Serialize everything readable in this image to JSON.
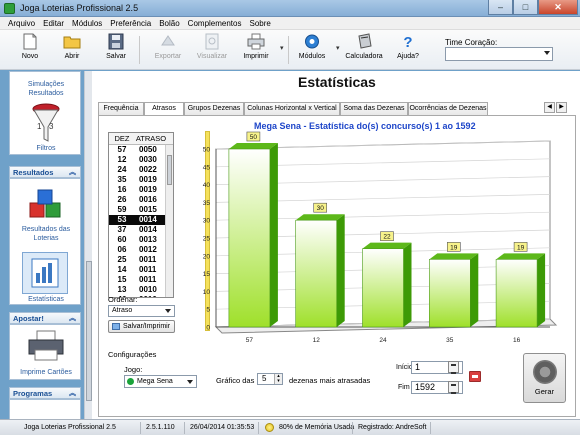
{
  "window": {
    "title": "Joga Loterias Profissional 2.5",
    "controls": [
      "–",
      "□",
      "✕"
    ]
  },
  "menu": [
    "Arquivo",
    "Editar",
    "Módulos",
    "Preferência",
    "Bolão",
    "Complementos",
    "Sobre"
  ],
  "toolbar": {
    "novo": "Novo",
    "abrir": "Abrir",
    "salvar": "Salvar",
    "exportar": "Exportar",
    "visualizar": "Visualizar",
    "imprimir": "Imprimir",
    "modulos": "Módulos",
    "calculadora": "Calculadora",
    "ajuda": "Ajuda?",
    "time_label": "Time Coração:",
    "time_value": ""
  },
  "sidebar": {
    "item_simulacoes": "Simulações Resultados",
    "item_filtros": "Filtros",
    "section_resultados": "Resultados",
    "item_resultados_loterias": "Resultados das Loterias",
    "item_estatisticas": "Estatísticas",
    "section_apostar": "Apostar!",
    "item_imprime_cartoes": "Imprime Cartões",
    "section_programas": "Programas",
    "chevron": "︽"
  },
  "main": {
    "title": "Estatísticas",
    "tabs": [
      "Frequência",
      "Atrasos",
      "Grupos Dezenas",
      "Colunas Horizontal x Vertical",
      "Soma das Dezenas",
      "Ocorrências de Dezenas"
    ],
    "active_tab": "Atrasos",
    "tab_prev": "◀",
    "tab_next": "▶"
  },
  "number_list": {
    "col_dez": "DEZ",
    "col_atraso": "ATRASO",
    "rows": [
      {
        "dez": "57",
        "atraso": "0050"
      },
      {
        "dez": "12",
        "atraso": "0030"
      },
      {
        "dez": "24",
        "atraso": "0022"
      },
      {
        "dez": "35",
        "atraso": "0019"
      },
      {
        "dez": "16",
        "atraso": "0019"
      },
      {
        "dez": "26",
        "atraso": "0016"
      },
      {
        "dez": "59",
        "atraso": "0015"
      },
      {
        "dez": "53",
        "atraso": "0014"
      },
      {
        "dez": "37",
        "atraso": "0014"
      },
      {
        "dez": "60",
        "atraso": "0013"
      },
      {
        "dez": "06",
        "atraso": "0012"
      },
      {
        "dez": "25",
        "atraso": "0011"
      },
      {
        "dez": "14",
        "atraso": "0011"
      },
      {
        "dez": "15",
        "atraso": "0011"
      },
      {
        "dez": "13",
        "atraso": "0010"
      },
      {
        "dez": "46",
        "atraso": "0010"
      }
    ],
    "selected_dez": "53"
  },
  "ordenar": {
    "label": "Ordenar:",
    "value": "Atraso",
    "save_print": "Salvar/Imprimir"
  },
  "chart_data": {
    "type": "bar",
    "title": "Mega Sena - Estatística do(s) concurso(s) 1 ao 1592",
    "categories": [
      "57",
      "12",
      "24",
      "35",
      "16"
    ],
    "values": [
      50,
      30,
      22,
      19,
      19
    ],
    "ylim": [
      0,
      50
    ],
    "yticks": [
      0,
      5,
      10,
      15,
      20,
      25,
      30,
      35,
      40,
      45,
      50
    ],
    "xlabel": "",
    "ylabel": "",
    "grid": true,
    "colors": {
      "bar_light": "#eafcb4",
      "bar_dark": "#3d9a06",
      "label_bg": "#f7f28b"
    }
  },
  "config": {
    "section_label": "Configurações",
    "jogo_label": "Jogo:",
    "jogo_value": "Mega Sena",
    "grafico_label": "Gráfico das",
    "grafico_value": "5",
    "dezenas_label": "dezenas mais atrasadas",
    "inicio_label": "Início",
    "inicio_value": "1",
    "fim_label": "Fim",
    "fim_value": "1592",
    "gerar_label": "Gerar"
  },
  "statusbar": {
    "app": "Joga Loterias Profissional 2.5",
    "version": "2.5.1.110",
    "datetime": "26/04/2014 01:35:53",
    "memory": "80% de Memória Usada",
    "registered": "Registrado: AndreSoft"
  }
}
